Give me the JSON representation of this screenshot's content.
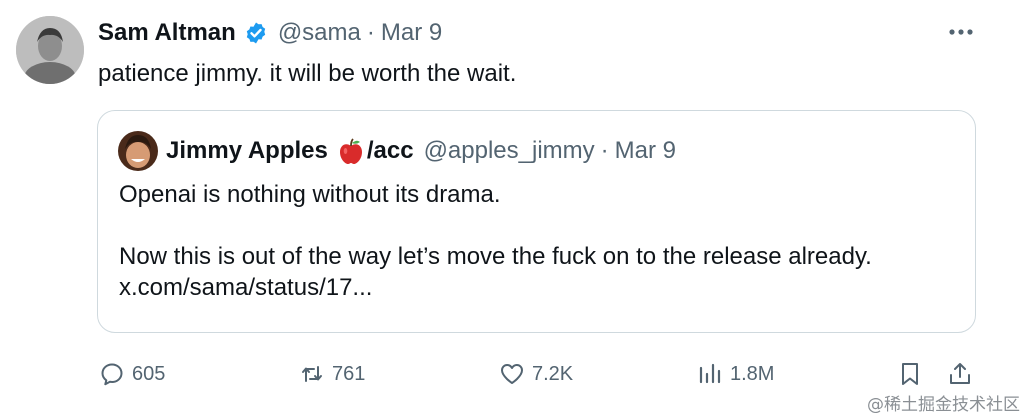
{
  "author": {
    "name": "Sam Altman",
    "handle": "@sama",
    "separator": "·",
    "date": "Mar 9",
    "verified": true
  },
  "tweet_text": "patience jimmy. it will be worth the wait.",
  "quoted": {
    "name": "Jimmy Apples",
    "name_emoji": "apple-emoji",
    "name_suffix": "/acc",
    "handle": "@apples_jimmy",
    "separator": "·",
    "date": "Mar 9",
    "line1": "Openai is nothing without its drama.",
    "line2": "Now this is out of the way let’s move the fuck on to the release already.",
    "link": "x.com/sama/status/17..."
  },
  "actions": {
    "replies": "605",
    "reposts": "761",
    "likes": "7.2K",
    "views": "1.8M"
  },
  "watermark": "@稀土掘金技术社区",
  "colors": {
    "text": "#0f1419",
    "secondary": "#536471",
    "verified": "#1d9bf0",
    "border": "#cfd9de"
  }
}
